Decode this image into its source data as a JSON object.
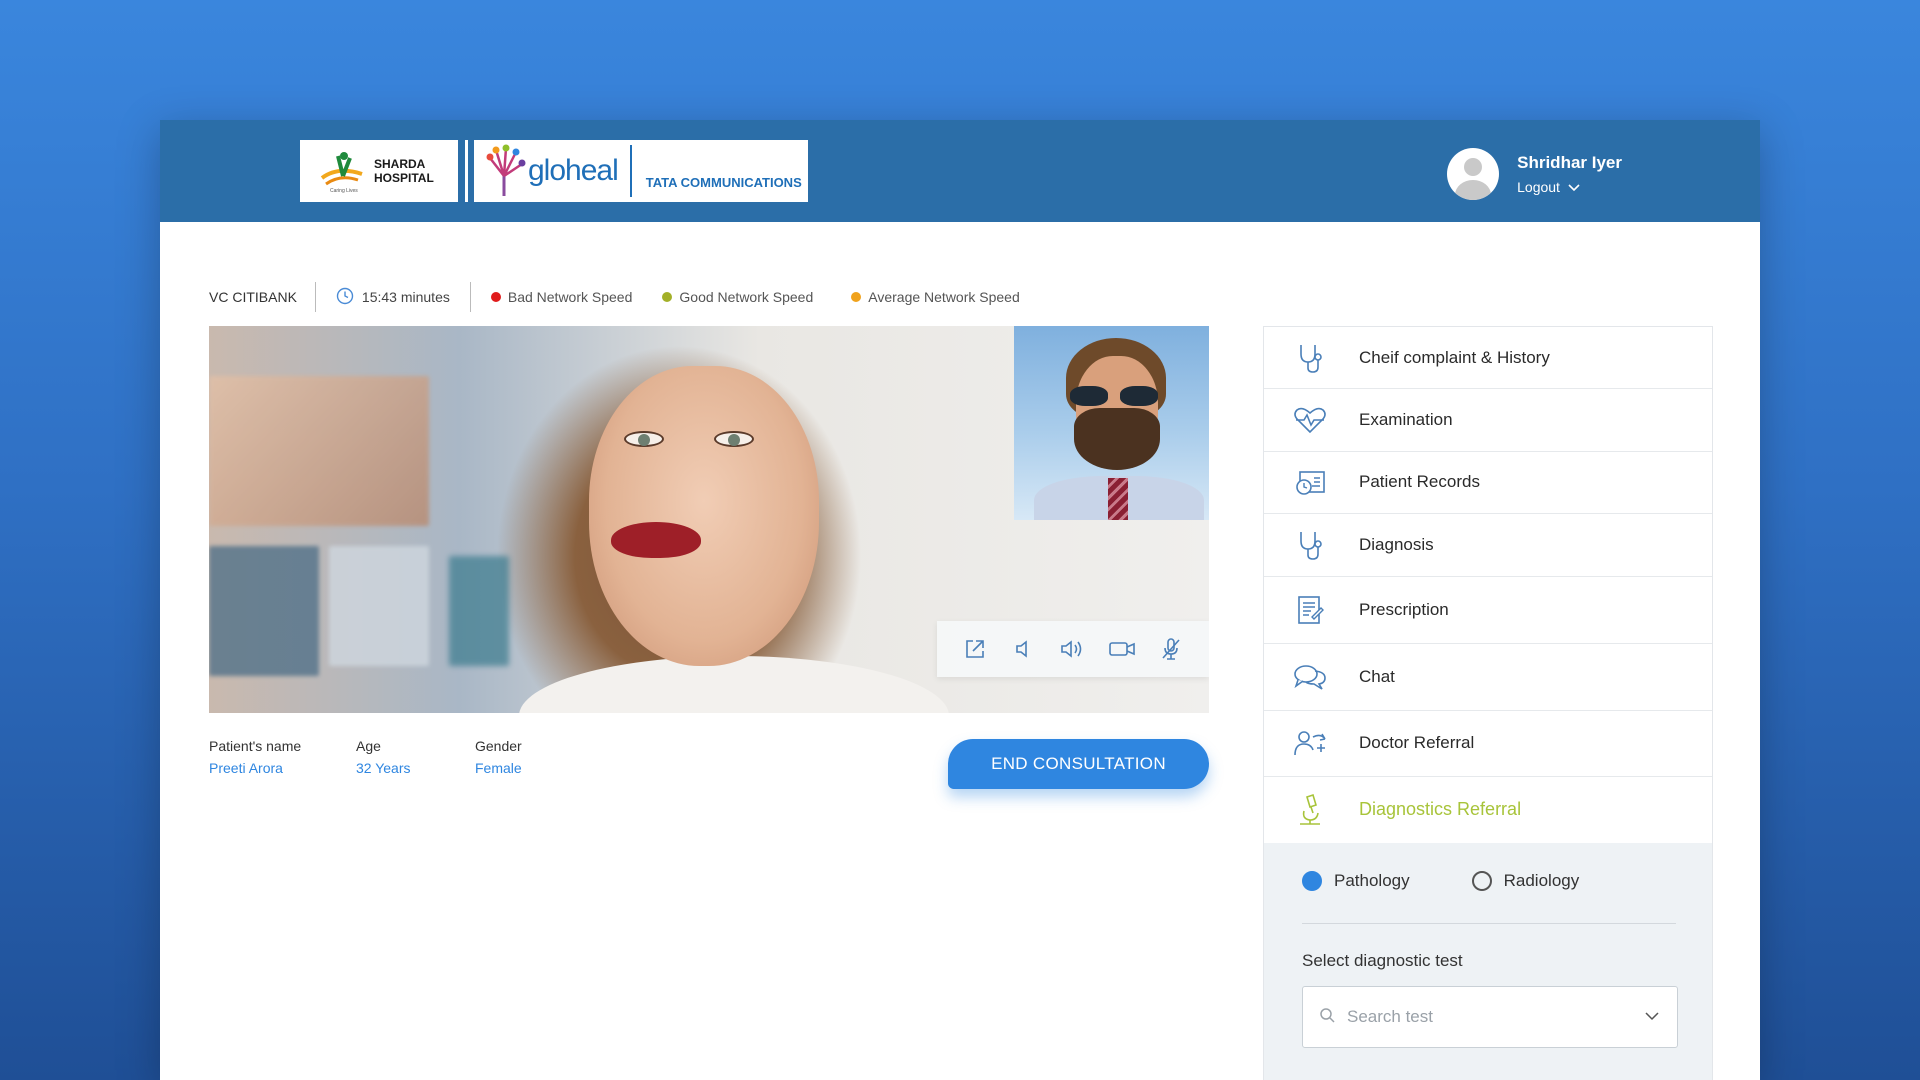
{
  "header": {
    "logos": {
      "sharda": {
        "line1": "SHARDA",
        "line2": "HOSPITAL",
        "tagline": "Caring Lives"
      },
      "gloheal": "gloheal",
      "tata": "TATA COMMUNICATIONS"
    },
    "user": {
      "name": "Shridhar Iyer",
      "logout": "Logout"
    }
  },
  "status": {
    "session": "VC CITIBANK",
    "timer": "15:43 minutes",
    "legend": [
      {
        "label": "Bad Network Speed",
        "color": "#e01b1b"
      },
      {
        "label": "Good Network Speed",
        "color": "#a3b028"
      },
      {
        "label": "Average Network Speed",
        "color": "#f0a21c"
      }
    ]
  },
  "video_controls": [
    "external-link-icon",
    "speaker-low-icon",
    "speaker-high-icon",
    "video-camera-icon",
    "mic-off-icon"
  ],
  "patient": {
    "name_label": "Patient's name",
    "name": "Preeti Arora",
    "age_label": "Age",
    "age": "32 Years",
    "gender_label": "Gender",
    "gender": "Female"
  },
  "end_button": "END CONSULTATION",
  "menu": [
    {
      "label": "Cheif complaint & History",
      "icon": "stethoscope-icon"
    },
    {
      "label": "Examination",
      "icon": "heart-pulse-icon"
    },
    {
      "label": "Patient Records",
      "icon": "records-icon"
    },
    {
      "label": "Diagnosis",
      "icon": "stethoscope-icon"
    },
    {
      "label": "Prescription",
      "icon": "prescription-icon"
    },
    {
      "label": "Chat",
      "icon": "chat-icon"
    },
    {
      "label": "Doctor Referral",
      "icon": "doctor-referral-icon"
    },
    {
      "label": "Diagnostics Referral",
      "icon": "microscope-icon",
      "active": true
    }
  ],
  "diagnostics": {
    "options": [
      {
        "label": "Pathology",
        "selected": true
      },
      {
        "label": "Radiology",
        "selected": false
      }
    ],
    "select_label": "Select diagnostic test",
    "search_placeholder": "Search test"
  },
  "colors": {
    "accent": "#2f86e0",
    "header": "#2b6ea8",
    "active": "#a8c43a"
  }
}
